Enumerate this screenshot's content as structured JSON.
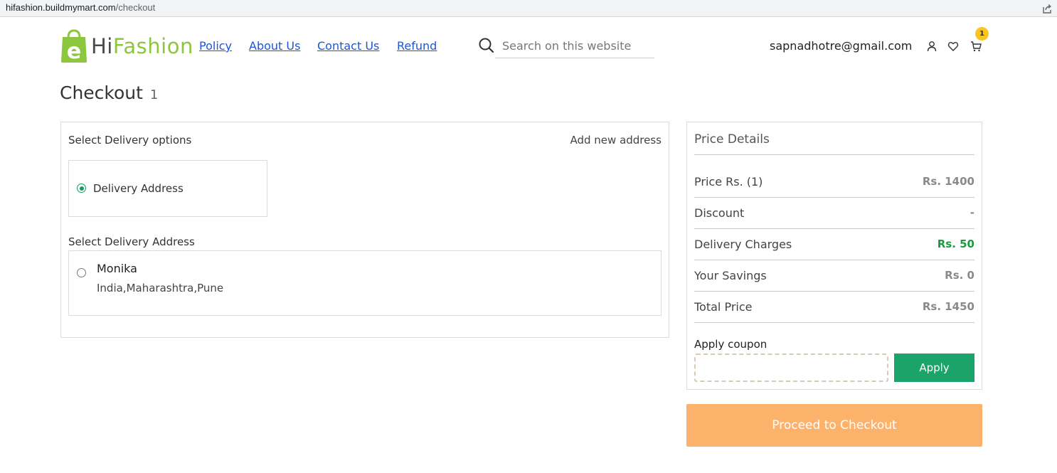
{
  "browser": {
    "url_host": "hifashion.buildmymart.com",
    "url_path": "/checkout"
  },
  "brand": {
    "hi": "Hi",
    "fashion": "Fashion",
    "logo_letter": "e",
    "color": "#8dc63f"
  },
  "nav": [
    {
      "label": "Policy"
    },
    {
      "label": "About Us"
    },
    {
      "label": "Contact Us"
    },
    {
      "label": "Refund"
    }
  ],
  "search": {
    "placeholder": "Search on this website"
  },
  "account": {
    "email": "sapnadhotre@gmail.com",
    "cart_count": "1"
  },
  "page": {
    "title": "Checkout",
    "count": "1"
  },
  "delivery": {
    "options_label": "Select Delivery options",
    "add_new_address": "Add new address",
    "option": "Delivery Address",
    "address_label": "Select Delivery Address",
    "address": {
      "name": "Monika",
      "line": "India,Maharashtra,Pune"
    }
  },
  "price": {
    "title": "Price Details",
    "rows": [
      {
        "label": "Price Rs. (1)",
        "value": "Rs. 1400"
      },
      {
        "label": "Discount",
        "value": "-"
      },
      {
        "label": "Delivery Charges",
        "value": "Rs. 50"
      },
      {
        "label": "Your Savings",
        "value": "Rs. 0"
      },
      {
        "label": "Total Price",
        "value": "Rs. 1450"
      }
    ],
    "coupon_label": "Apply coupon",
    "coupon_value": "",
    "apply_label": "Apply"
  },
  "checkout_label": "Proceed to Checkout",
  "colors": {
    "accent_green": "#1aa46a",
    "checkout_orange": "#fdb26b",
    "badge_yellow": "#f7c623",
    "link_blue": "#1a56db"
  }
}
